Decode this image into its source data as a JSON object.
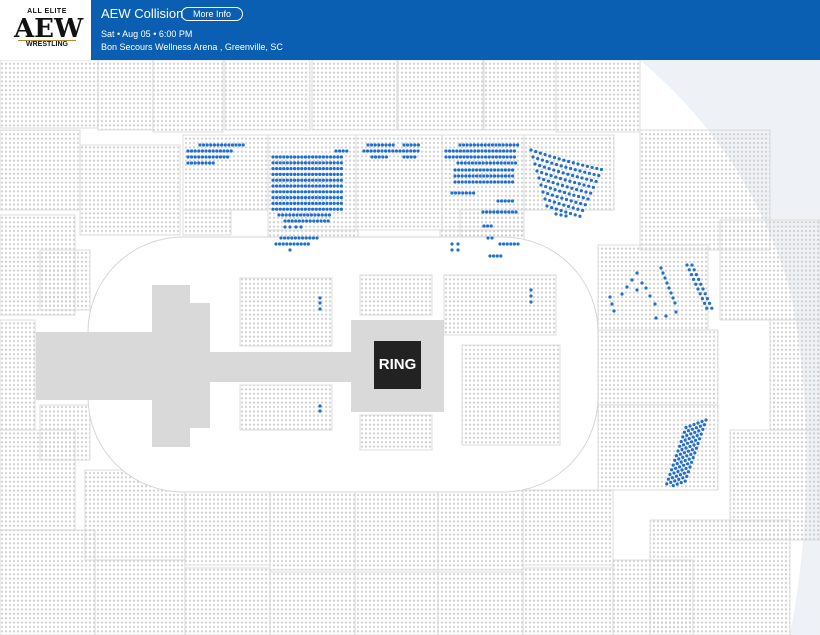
{
  "header": {
    "logo": {
      "top_text": "ALL ELITE",
      "mark": "AEW",
      "bottom_text": "WRESTLING"
    },
    "title": "AEW Collision",
    "more_info_label": "More Info",
    "date_line": "Sat • Aug 05 • 6:00 PM",
    "venue_line": "Bon Secours Wellness Arena , Greenville, SC"
  },
  "map": {
    "ring_label": "RING",
    "colors": {
      "header_bg": "#0b5fb3",
      "available_seat": "#1e6fd0",
      "unavailable_seat": "#cfcfcf",
      "section_outline": "#d6d6d6",
      "stage": "#d9d9d9",
      "ring": "#222222"
    }
  }
}
